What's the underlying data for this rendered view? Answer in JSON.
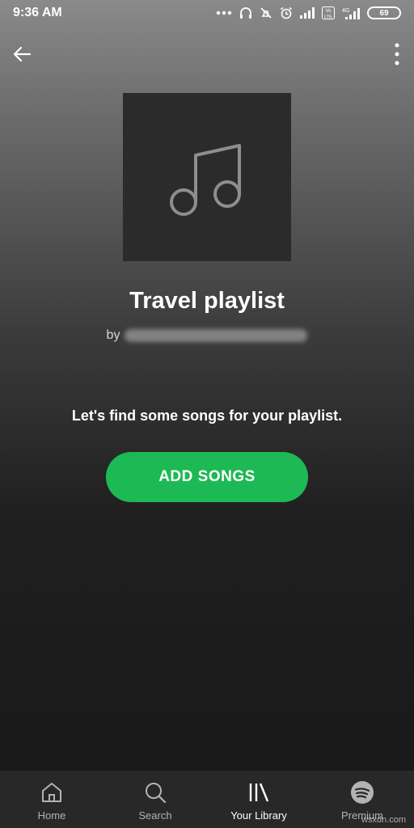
{
  "status_bar": {
    "time": "9:36 AM",
    "battery": "69",
    "network": "4G",
    "volte": "Vo LTE",
    "icons": [
      "dots-icon",
      "headphones-icon",
      "mute-icon",
      "alarm-icon",
      "signal-icon",
      "volte-icon",
      "signal-4g-icon",
      "battery-icon"
    ]
  },
  "header": {
    "back_icon": "arrow-left-icon",
    "menu_icon": "more-vertical-icon"
  },
  "playlist": {
    "cover_icon": "music-note-icon",
    "title": "Travel playlist",
    "by_label": "by"
  },
  "empty_state": {
    "message": "Let's find some songs for your playlist.",
    "button_label": "ADD SONGS"
  },
  "nav": {
    "items": [
      {
        "label": "Home",
        "icon": "home-icon",
        "active": false
      },
      {
        "label": "Search",
        "icon": "search-icon",
        "active": false
      },
      {
        "label": "Your Library",
        "icon": "library-icon",
        "active": true
      },
      {
        "label": "Premium",
        "icon": "spotify-icon",
        "active": false
      }
    ]
  },
  "watermark": "wsxdn.com",
  "colors": {
    "accent": "#1db954",
    "navbar": "#282828",
    "cover": "#2b2b2b"
  }
}
